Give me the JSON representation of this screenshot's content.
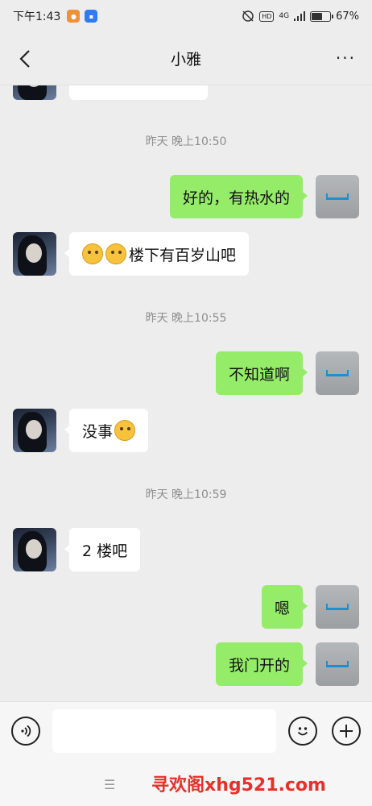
{
  "status_bar": {
    "time": "下午1:43",
    "app_icons": [
      "app-orange-icon",
      "app-blue-icon"
    ],
    "network": "4G",
    "hd": "HD",
    "battery_percent": 67,
    "battery_label": "67%"
  },
  "header": {
    "title": "小雅",
    "more": "···"
  },
  "messages": [
    {
      "type": "partial",
      "from": "her"
    },
    {
      "type": "time",
      "text": "昨天 晚上10:50"
    },
    {
      "type": "text",
      "from": "me",
      "text": "好的，有热水的"
    },
    {
      "type": "text",
      "from": "her",
      "emojis": 2,
      "text": "楼下有百岁山吧"
    },
    {
      "type": "time",
      "text": "昨天 晚上10:55"
    },
    {
      "type": "text",
      "from": "me",
      "text": "不知道啊"
    },
    {
      "type": "text",
      "from": "her",
      "text": "没事",
      "emojis_after": 1
    },
    {
      "type": "time",
      "text": "昨天 晚上10:59"
    },
    {
      "type": "text",
      "from": "her",
      "text": "2 楼吧"
    },
    {
      "type": "text",
      "from": "me",
      "text": "嗯"
    },
    {
      "type": "text",
      "from": "me",
      "text": "我门开的"
    }
  ],
  "input_bar": {
    "voice_icon": "voice-icon",
    "emoji_icon": "emoji-icon",
    "plus_icon": "plus-icon",
    "text_value": ""
  },
  "system_nav": {
    "menu": "☰",
    "watermark": "寻欢阁xhg521.com"
  },
  "colors": {
    "my_bubble": "#95ec69",
    "her_bubble": "#ffffff",
    "background": "#ededed",
    "watermark": "#e8302b"
  }
}
